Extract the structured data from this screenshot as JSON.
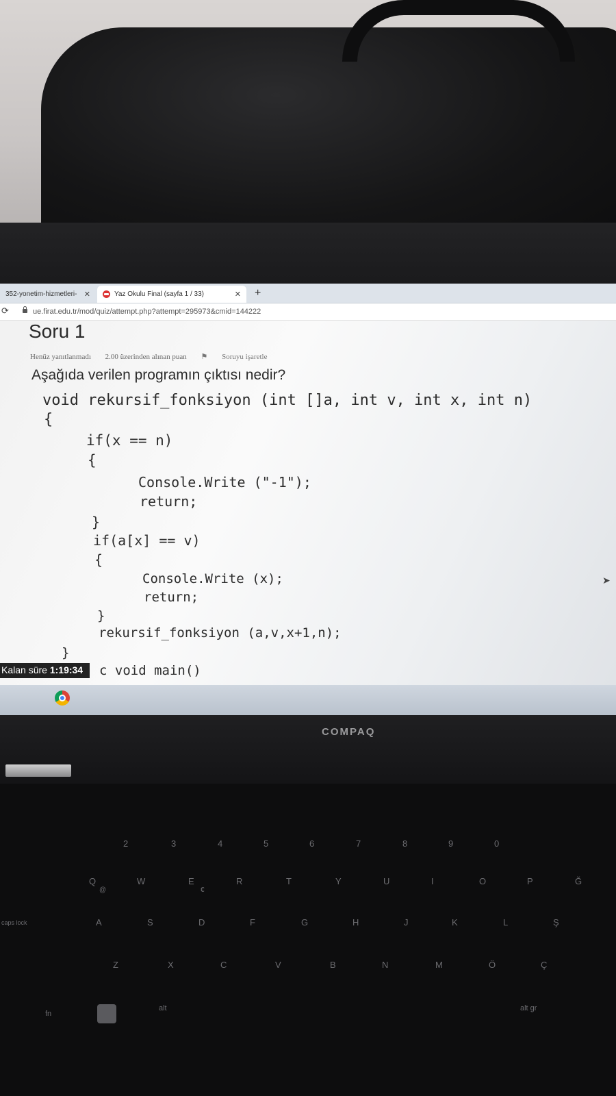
{
  "browser": {
    "tabs": [
      {
        "label": "352-yonetim-hizmetleri-",
        "close": "✕"
      },
      {
        "label": "Yaz Okulu Final (sayfa 1 / 33)",
        "close": "✕"
      }
    ],
    "new_tab": "+",
    "reload_icon": "reload-icon",
    "url": "ue.firat.edu.tr/mod/quiz/attempt.php?attempt=295973&cmid=144222"
  },
  "question": {
    "title": "Soru 1",
    "status": "Henüz yanıtlanmadı",
    "points": "2.00 üzerinden alınan puan",
    "flag_label": "Soruyu işaretle",
    "prompt": "Aşağıda verilen programın çıktısı nedir?",
    "code_lines": [
      "void rekursif_fonksiyon (int []a, int v, int x, int n)",
      "{",
      "if(x == n)",
      "{",
      "Console.Write (\"-1\");",
      "return;",
      "}",
      "if(a[x] == v)",
      "{",
      "Console.Write (x);",
      "return;",
      "}",
      "rekursif_fonksiyon (a,v,x+1,n);",
      "}",
      "c void main()"
    ]
  },
  "timer": {
    "label": "Kalan süre",
    "value": "1:19:34"
  },
  "laptop": {
    "brand": "COMPAQ",
    "keys": [
      "Q",
      "W",
      "E",
      "R",
      "T",
      "Y",
      "U",
      "I",
      "O",
      "P",
      "Ğ",
      "A",
      "S",
      "D",
      "F",
      "G",
      "H",
      "J",
      "K",
      "L",
      "Ş",
      "Z",
      "X",
      "C",
      "V",
      "B",
      "N",
      "M",
      "Ö",
      "Ç",
      "2",
      "3",
      "4",
      "5",
      "6",
      "7",
      "8",
      "9",
      "0",
      "alt gr",
      "alt",
      "fn",
      "caps lock",
      "@",
      "€"
    ]
  }
}
